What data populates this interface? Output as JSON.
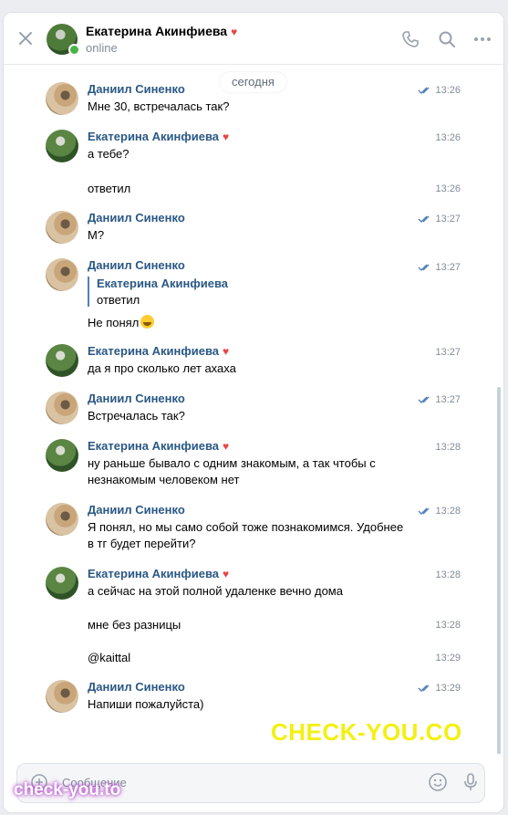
{
  "header": {
    "name": "Екатерина Акинфиева",
    "status": "online"
  },
  "feed": {
    "date_label": "сегодня",
    "messages": [
      {
        "author": "Даниил Синенко",
        "text": "Мне 30, встречалась так?",
        "time": "13:26"
      },
      {
        "author": "Екатерина Акинфиева",
        "text": "а тебе?",
        "time": "13:26"
      },
      {
        "text": "ответил",
        "time": "13:26"
      },
      {
        "author": "Даниил Синенко",
        "text": "М?",
        "time": "13:27"
      },
      {
        "author": "Даниил Синенко",
        "reply_author": "Екатерина Акинфиева",
        "reply_text": "ответил",
        "text": "Не понял",
        "time": "13:27"
      },
      {
        "author": "Екатерина Акинфиева",
        "text": "да я про сколько лет ахаха",
        "time": "13:27"
      },
      {
        "author": "Даниил Синенко",
        "text": "Встречалась так?",
        "time": "13:27"
      },
      {
        "author": "Екатерина Акинфиева",
        "text_line1": "ну раньше бывало с одним знакомым, а так чтобы с",
        "text_line2": "незнакомым человеком нет",
        "time": "13:28"
      },
      {
        "author": "Даниил Синенко",
        "text_line1": "Я понял, но мы само собой тоже познакомимся. Удобнее",
        "text_line2": "в тг будет перейти?",
        "time": "13:28"
      },
      {
        "author": "Екатерина Акинфиева",
        "text": "а сейчас на этой полной удаленке вечно дома",
        "time": "13:28"
      },
      {
        "text": "мне без разницы",
        "time": "13:28"
      },
      {
        "text": "@kaittal",
        "time": "13:29"
      },
      {
        "author": "Даниил Синенко",
        "text": "Напиши пожалуйста)",
        "time": "13:29"
      }
    ]
  },
  "composer": {
    "placeholder": "Сообщение"
  },
  "watermarks": {
    "top": "CHECK-YOU.CO",
    "bottom": "check-you.to"
  },
  "colors": {
    "accent": "#2a5885",
    "heart": "#e64646",
    "online": "#4bb34b"
  }
}
